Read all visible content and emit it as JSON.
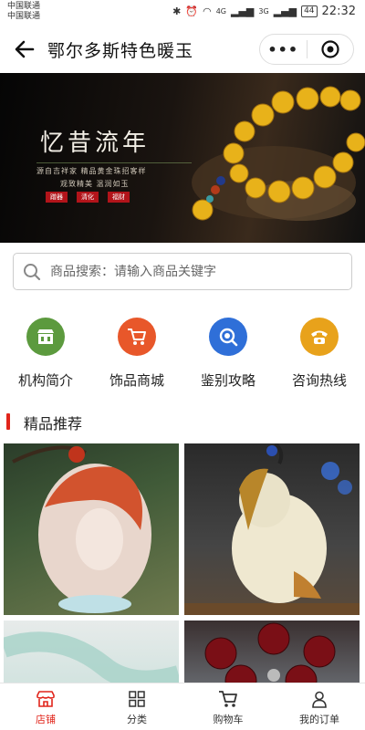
{
  "status_bar": {
    "carrier_1": "中国联通",
    "carrier_2": "中国联通",
    "net_1": "4G",
    "net_2": "3G",
    "battery": "44",
    "time": "22:32"
  },
  "nav": {
    "title": "鄂尔多斯特色暖玉",
    "more": "•••"
  },
  "banner": {
    "title": "忆昔流年",
    "subtitle_1": "源自吉祥家 精品黄金珠招客样",
    "subtitle_2": "观致精美 温润如玉",
    "tags": [
      "蹭器",
      "清化",
      "福财"
    ]
  },
  "search": {
    "placeholder": "商品搜索：请输入商品关键字",
    "value": ""
  },
  "categories": [
    {
      "label": "机构简介",
      "color": "#5c9a3e",
      "icon": "store-icon"
    },
    {
      "label": "饰品商城",
      "color": "#e8572a",
      "icon": "cart-icon"
    },
    {
      "label": "鉴别攻略",
      "color": "#2f6fd8",
      "icon": "magnifier-icon"
    },
    {
      "label": "咨询热线",
      "color": "#e8a21b",
      "icon": "phone-icon"
    }
  ],
  "section": {
    "title": "精品推荐",
    "accent": "#e1251b"
  },
  "products": [
    {
      "icon": "agate-guanyin-pendant"
    },
    {
      "icon": "white-jade-buddha-pendant"
    },
    {
      "icon": "jade-bangle"
    },
    {
      "icon": "red-bead-bracelet"
    }
  ],
  "tabbar": {
    "accent": "#e1251b",
    "items": [
      {
        "label": "店铺",
        "active": true
      },
      {
        "label": "分类",
        "active": false
      },
      {
        "label": "购物车",
        "active": false
      },
      {
        "label": "我的订单",
        "active": false
      }
    ]
  }
}
